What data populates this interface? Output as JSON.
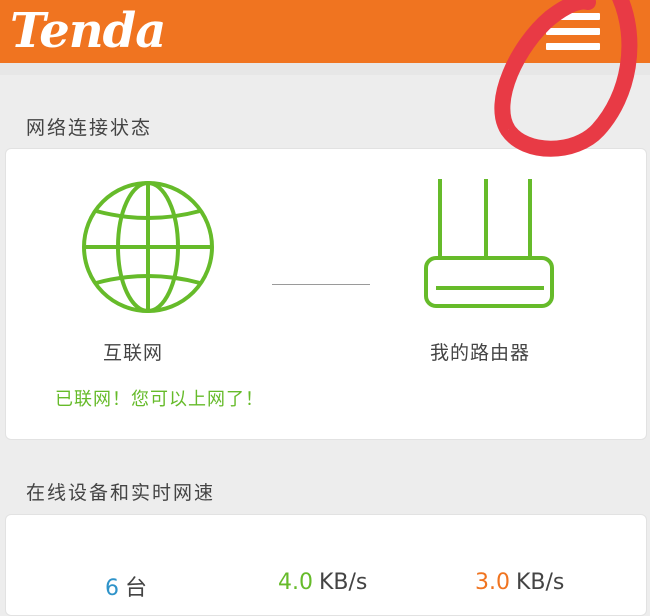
{
  "header": {
    "logo_text": "Tenda",
    "menu_icon": "hamburger-menu-icon"
  },
  "connection": {
    "section_title": "网络连接状态",
    "internet_label": "互联网",
    "router_label": "我的路由器",
    "status_text": "已联网！您可以上网了！",
    "globe_icon": "globe-icon",
    "router_icon": "router-icon"
  },
  "devices": {
    "section_title": "在线设备和实时网速",
    "device_count": "6",
    "device_unit": "台",
    "download_value": "4.0",
    "download_unit": "KB/s",
    "upload_value": "3.0",
    "upload_unit": "KB/s"
  },
  "colors": {
    "brand_orange": "#f07420",
    "status_green": "#66bb2a",
    "count_blue": "#2e93c9",
    "annotation_red": "#e83a45"
  }
}
